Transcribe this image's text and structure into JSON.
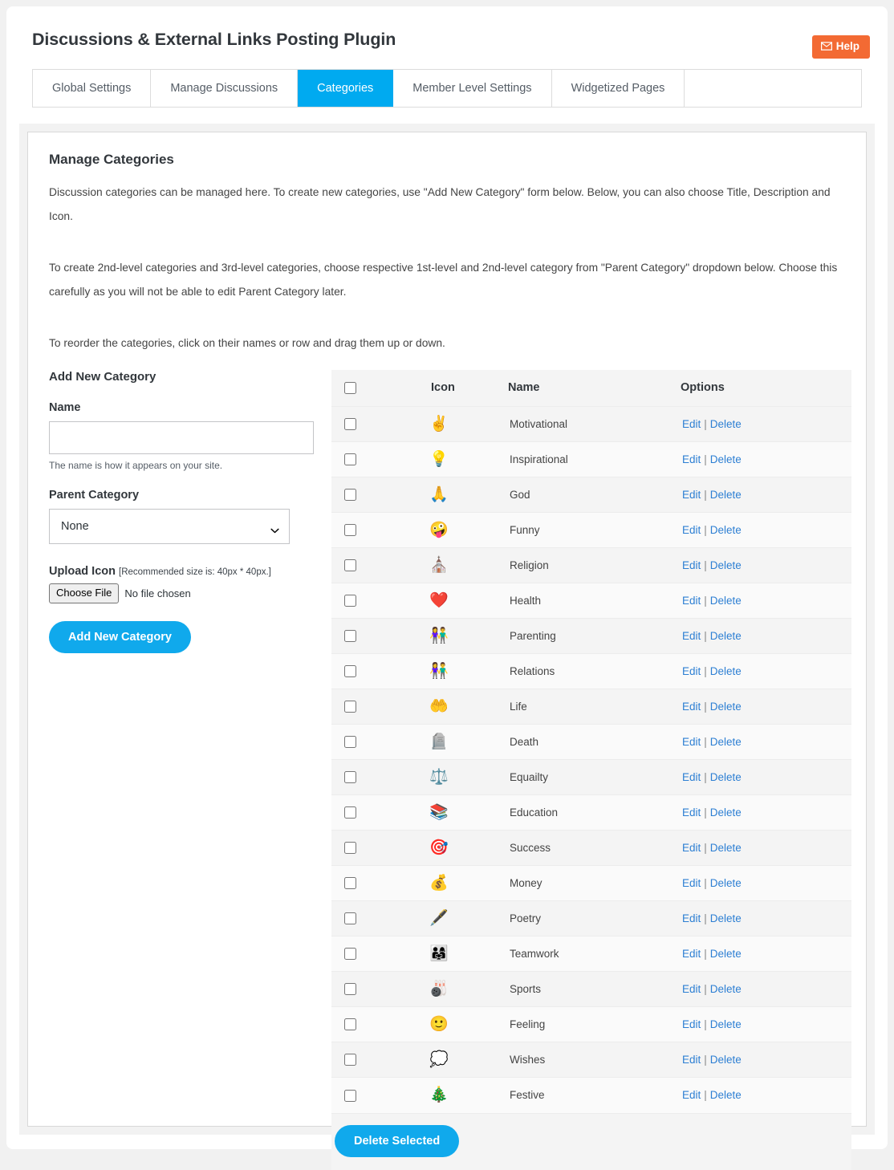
{
  "header": {
    "title": "Discussions & External Links Posting Plugin",
    "help_label": "Help",
    "help_icon": "mail-icon",
    "help_color": "#f36a33"
  },
  "tabs": [
    {
      "label": "Global Settings",
      "active": false
    },
    {
      "label": "Manage Discussions",
      "active": false
    },
    {
      "label": "Categories",
      "active": true
    },
    {
      "label": "Member Level Settings",
      "active": false
    },
    {
      "label": "Widgetized Pages",
      "active": false
    }
  ],
  "panel": {
    "section_title": "Manage Categories",
    "paragraphs": [
      "Discussion categories can be managed here. To create new categories, use \"Add New Category\" form below. Below, you can also choose Title, Description and Icon.",
      "To create 2nd-level categories and 3rd-level categories, choose respective 1st-level and 2nd-level category from \"Parent Category\" dropdown below. Choose this carefully as you will not be able to edit Parent Category later.",
      "To reorder the categories, click on their names or row and drag them up or down."
    ]
  },
  "form": {
    "heading": "Add New Category",
    "name_label": "Name",
    "name_value": "",
    "name_placeholder": "",
    "name_hint": "The name is how it appears on your site.",
    "parent_label": "Parent Category",
    "parent_selected": "None",
    "parent_options": [
      "None"
    ],
    "upload_label": "Upload Icon",
    "upload_recommendation": "[Recommended size is: 40px * 40px.]",
    "choose_file_label": "Choose File",
    "file_status": "No file chosen",
    "submit_label": "Add New Category",
    "submit_color": "#10a9ec"
  },
  "table": {
    "columns": [
      "",
      "Icon",
      "Name",
      "Options"
    ],
    "edit_label": "Edit",
    "delete_label": "Delete",
    "separator": "|",
    "select_all_checked": false,
    "rows": [
      {
        "icon": "✌️",
        "icon_name": "victory-hand-icon",
        "name": "Motivational",
        "checked": false
      },
      {
        "icon": "💡",
        "icon_name": "light-bulb-icon",
        "name": "Inspirational",
        "checked": false
      },
      {
        "icon": "🙏",
        "icon_name": "praying-person-icon",
        "name": "God",
        "checked": false
      },
      {
        "icon": "🤪",
        "icon_name": "zany-face-icon",
        "name": "Funny",
        "checked": false
      },
      {
        "icon": "⛪",
        "icon_name": "church-icon",
        "name": "Religion",
        "checked": false
      },
      {
        "icon": "❤️",
        "icon_name": "beating-heart-icon",
        "name": "Health",
        "checked": false
      },
      {
        "icon": "👫",
        "icon_name": "family-icon",
        "name": "Parenting",
        "checked": false
      },
      {
        "icon": "👫",
        "icon_name": "couple-icon",
        "name": "Relations",
        "checked": false
      },
      {
        "icon": "🤲",
        "icon_name": "heart-in-hands-icon",
        "name": "Life",
        "checked": false
      },
      {
        "icon": "🪦",
        "icon_name": "headstone-icon",
        "name": "Death",
        "checked": false
      },
      {
        "icon": "⚖️",
        "icon_name": "balance-scale-icon",
        "name": "Equailty",
        "checked": false
      },
      {
        "icon": "📚",
        "icon_name": "books-icon",
        "name": "Education",
        "checked": false
      },
      {
        "icon": "🎯",
        "icon_name": "target-icon",
        "name": "Success",
        "checked": false
      },
      {
        "icon": "💰",
        "icon_name": "money-bag-icon",
        "name": "Money",
        "checked": false
      },
      {
        "icon": "🖋️",
        "icon_name": "quill-pen-icon",
        "name": "Poetry",
        "checked": false
      },
      {
        "icon": "👨‍👩‍👧",
        "icon_name": "team-group-icon",
        "name": "Teamwork",
        "checked": false
      },
      {
        "icon": "🎳",
        "icon_name": "bowling-icon",
        "name": "Sports",
        "checked": false
      },
      {
        "icon": "🙂",
        "icon_name": "slightly-smiling-face-icon",
        "name": "Feeling",
        "checked": false
      },
      {
        "icon": "💭",
        "icon_name": "thought-balloon-icon",
        "name": "Wishes",
        "checked": false
      },
      {
        "icon": "🎄",
        "icon_name": "christmas-tree-icon",
        "name": "Festive",
        "checked": false
      }
    ],
    "delete_selected_label": "Delete Selected",
    "delete_selected_color": "#10a9ec"
  }
}
